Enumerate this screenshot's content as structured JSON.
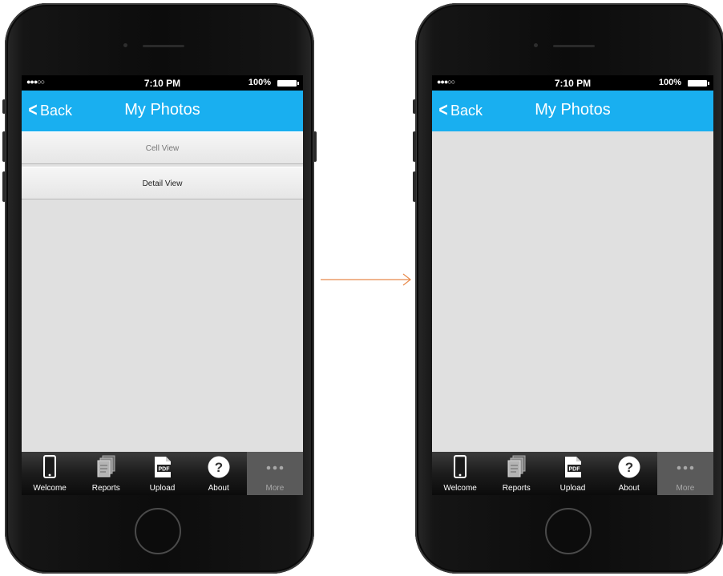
{
  "phones": [
    {
      "status": {
        "time": "7:10 PM",
        "battery": "100%"
      },
      "nav": {
        "back_label": "Back",
        "title": "My Photos"
      },
      "list": [
        {
          "label": "Cell View",
          "color": "#777777"
        },
        {
          "label": "Detail View",
          "color": "#222222"
        }
      ],
      "tabs": [
        {
          "label": "Welcome",
          "icon": "phone-icon"
        },
        {
          "label": "Reports",
          "icon": "reports-icon"
        },
        {
          "label": "Upload",
          "icon": "pdf-icon"
        },
        {
          "label": "About",
          "icon": "help-icon"
        },
        {
          "label": "More",
          "icon": "more-icon"
        }
      ]
    },
    {
      "status": {
        "time": "7:10 PM",
        "battery": "100%"
      },
      "nav": {
        "back_label": "Back",
        "title": "My Photos"
      },
      "list": [],
      "tabs": [
        {
          "label": "Welcome",
          "icon": "phone-icon"
        },
        {
          "label": "Reports",
          "icon": "reports-icon"
        },
        {
          "label": "Upload",
          "icon": "pdf-icon"
        },
        {
          "label": "About",
          "icon": "help-icon"
        },
        {
          "label": "More",
          "icon": "more-icon"
        }
      ]
    }
  ],
  "icons": {
    "pdf_text": "PDF",
    "help_glyph": "?"
  },
  "colors": {
    "nav_bar": "#19aff0",
    "arrow": "#e8894a",
    "screen_bg": "#e0e0e0"
  }
}
